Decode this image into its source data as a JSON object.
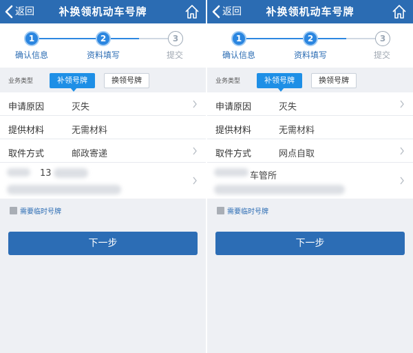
{
  "screens": [
    {
      "nav": {
        "back_label": "返回",
        "title": "补换领机动车号牌",
        "home_icon": "home-icon"
      },
      "steps": [
        {
          "number": "1",
          "label": "确认信息",
          "state": "active"
        },
        {
          "number": "2",
          "label": "资料填写",
          "state": "active"
        },
        {
          "number": "3",
          "label": "提交",
          "state": "pending"
        }
      ],
      "business_type": {
        "label": "业务类型",
        "options": [
          "补领号牌",
          "换领号牌"
        ],
        "selected": "补领号牌"
      },
      "rows": [
        {
          "key": "申请原因",
          "value": "灭失",
          "has_arrow": true
        },
        {
          "key": "提供材料",
          "value": "无需材料",
          "has_arrow": false
        },
        {
          "key": "取件方式",
          "value": "邮政寄递",
          "has_arrow": true
        }
      ],
      "address_partial": "13",
      "temp_plate_label": "需要临时号牌",
      "next_label": "下一步"
    },
    {
      "nav": {
        "back_label": "返回",
        "title": "补换领机动车号牌",
        "home_icon": "home-icon"
      },
      "steps": [
        {
          "number": "1",
          "label": "确认信息",
          "state": "active"
        },
        {
          "number": "2",
          "label": "资料填写",
          "state": "active"
        },
        {
          "number": "3",
          "label": "提交",
          "state": "pending"
        }
      ],
      "business_type": {
        "label": "业务类型",
        "options": [
          "补领号牌",
          "换领号牌"
        ],
        "selected": "补领号牌"
      },
      "rows": [
        {
          "key": "申请原因",
          "value": "灭失",
          "has_arrow": true
        },
        {
          "key": "提供材料",
          "value": "无需材料",
          "has_arrow": false
        },
        {
          "key": "取件方式",
          "value": "网点自取",
          "has_arrow": true
        }
      ],
      "address_partial": "车管所",
      "temp_plate_label": "需要临时号牌",
      "next_label": "下一步"
    }
  ],
  "colors": {
    "nav_bg": "#2b6cb3",
    "accent": "#1e8fe6",
    "button_bg": "#2c6db5",
    "page_bg": "#eef0f4"
  }
}
